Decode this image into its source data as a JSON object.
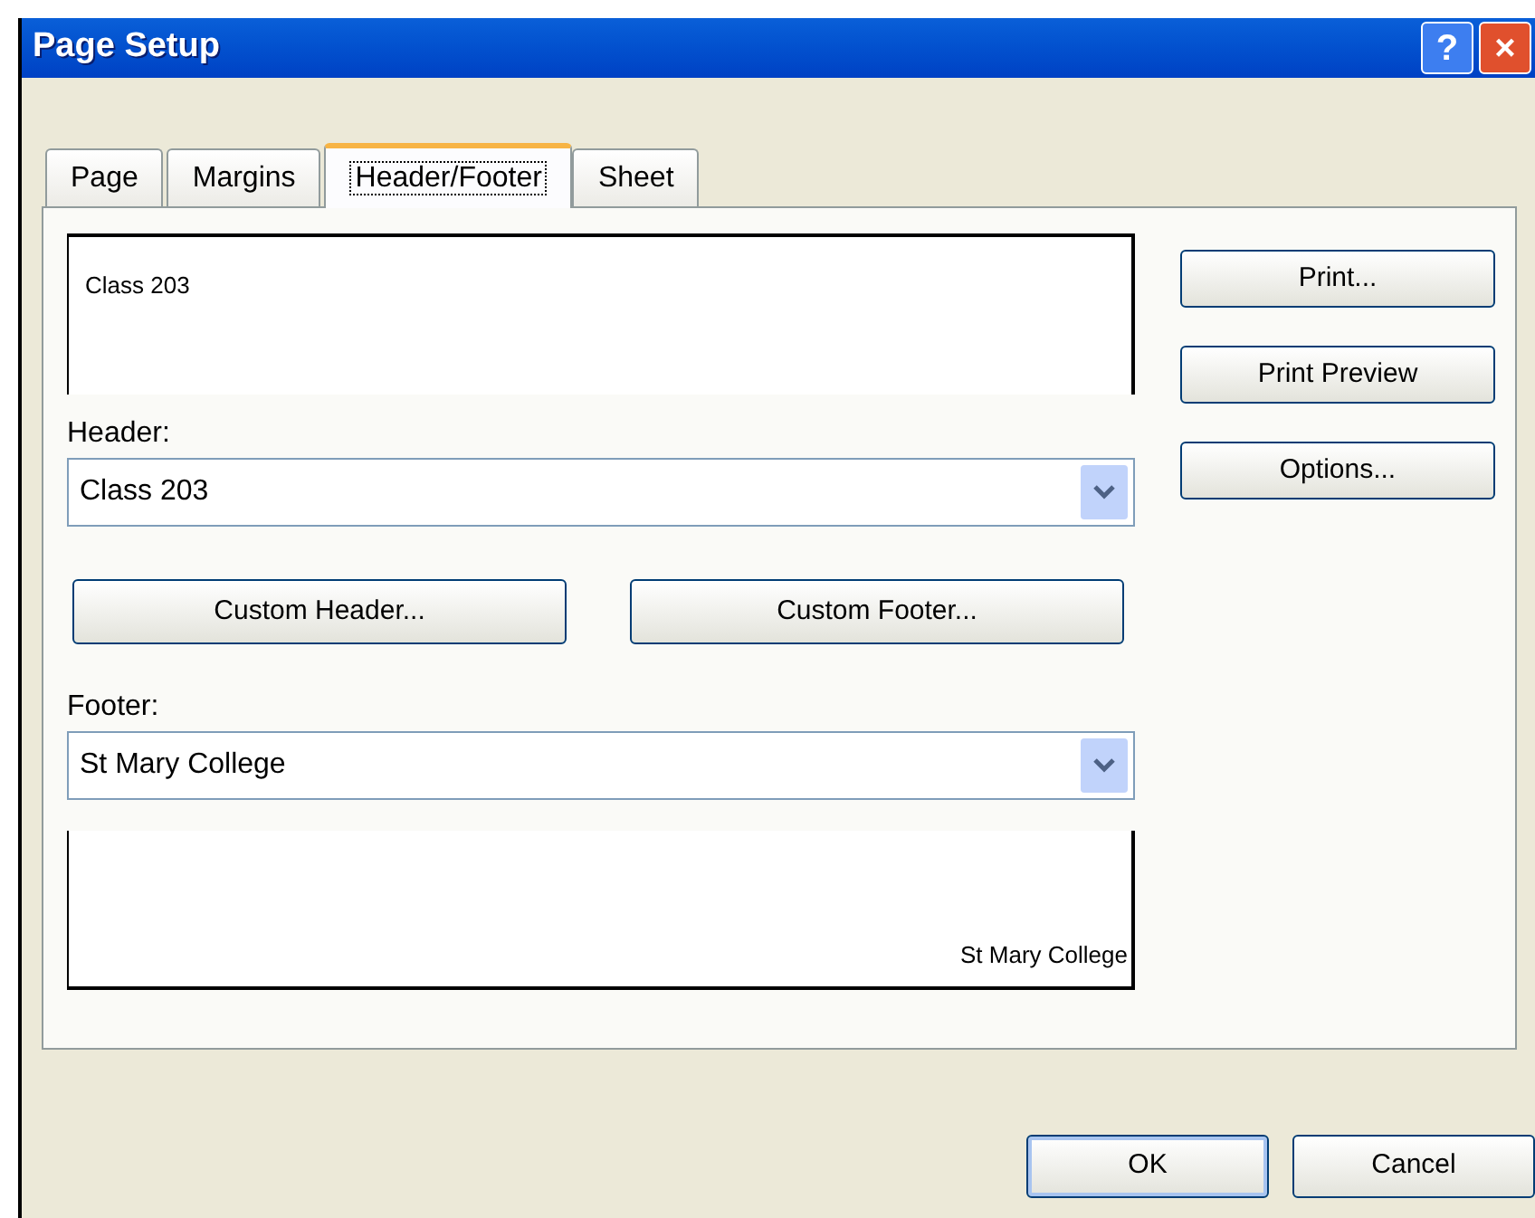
{
  "window": {
    "title": "Page Setup"
  },
  "title_buttons": [
    {
      "kind": "help",
      "label": "?"
    },
    {
      "kind": "close",
      "label": "×"
    }
  ],
  "tabs": [
    {
      "label": "Page",
      "selected": false
    },
    {
      "label": "Margins",
      "selected": false
    },
    {
      "label": "Header/Footer",
      "selected": true
    },
    {
      "label": "Sheet",
      "selected": false
    }
  ],
  "header_preview": {
    "text": "Class 203"
  },
  "header": {
    "label": "Header:",
    "value": "Class 203"
  },
  "custom_buttons": [
    "Custom Header...",
    "Custom Footer..."
  ],
  "footer": {
    "label": "Footer:",
    "value": "St Mary College"
  },
  "footer_preview": {
    "text": "St Mary College"
  },
  "side_buttons": [
    "Print...",
    "Print Preview",
    "Options..."
  ],
  "dialog_buttons": [
    {
      "label": "OK",
      "default": true
    },
    {
      "label": "Cancel",
      "default": false
    }
  ]
}
